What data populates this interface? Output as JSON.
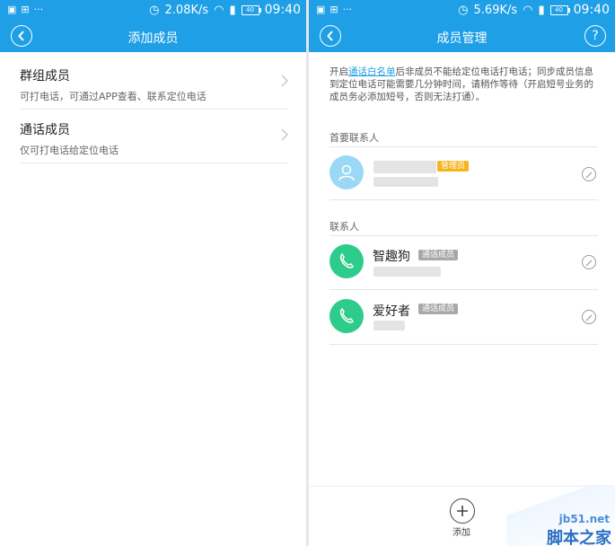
{
  "left": {
    "status": {
      "speed": "2.08K/s",
      "battery": "40",
      "time": "09:40"
    },
    "title": "添加成员",
    "rows": [
      {
        "title": "群组成员",
        "desc": "可打电话，可通过APP查看、联系定位电话"
      },
      {
        "title": "通话成员",
        "desc": "仅可打电话给定位电话"
      }
    ]
  },
  "right": {
    "status": {
      "speed": "5.69K/s",
      "battery": "40",
      "time": "09:40"
    },
    "title": "成员管理",
    "help": "?",
    "notice": {
      "prefix": "开启",
      "link": "通话白名单",
      "suffix": "后非成员不能给定位电话打电话；同步成员信息到定位电话可能需要几分钟时间，请稍作等待（开启短号业务的成员务必添加短号，否则无法打通）。"
    },
    "primary_label": "首要联系人",
    "admin_badge": "管理员",
    "contacts_label": "联系人",
    "contacts": [
      {
        "name": "智趣狗",
        "badge": "通话成员"
      },
      {
        "name": "爱好者",
        "badge": "通话成员"
      }
    ],
    "add_label": "添加"
  },
  "watermark": {
    "url": "jb51.net",
    "text": "脚本之家"
  },
  "colors": {
    "primary": "#1e9fe6",
    "admin": "#f5b51c",
    "call_badge": "#a8a8a8",
    "phone_avatar": "#2ecc8a",
    "person_avatar": "#9ad8f5"
  }
}
